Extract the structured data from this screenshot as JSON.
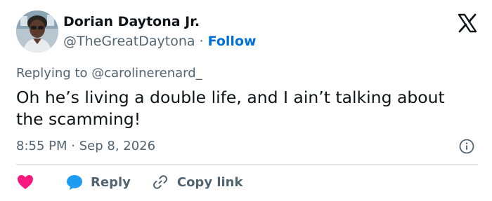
{
  "author": {
    "name": "Dorian Daytona Jr.",
    "handle": "@TheGreatDaytona",
    "separator": "·",
    "follow_label": "Follow",
    "avatar_icon": "profile-photo"
  },
  "tweet": {
    "replying_to": "Replying to @carolinerenard_",
    "text": "Oh he’s living a double life, and I ain’t talking about the scamming!",
    "time": "8:55 PM",
    "separator": "·",
    "date": "Sep 8, 2026"
  },
  "actions": {
    "heart_icon": "heart-icon",
    "reply_icon": "speech-bubble-icon",
    "reply_label": "Reply",
    "link_icon": "link-icon",
    "copy_link_label": "Copy link"
  },
  "icons": {
    "brand": "x-logo-icon",
    "info": "info-icon"
  },
  "colors": {
    "text_primary": "#0f1419",
    "text_secondary": "#536471",
    "follow": "#006fd6",
    "heart": "#f91880",
    "reply_bubble": "#1d9bf0",
    "divider": "#cfd9de"
  }
}
